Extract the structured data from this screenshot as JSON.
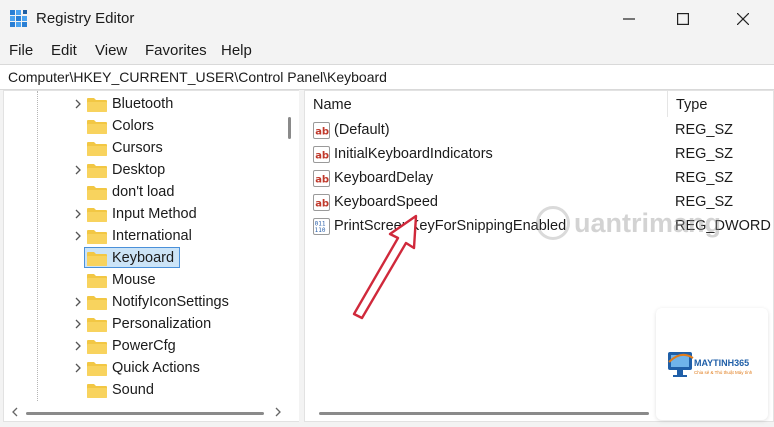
{
  "window": {
    "title": "Registry Editor",
    "icon": "registry-editor-icon",
    "controls": [
      "minimize-icon",
      "maximize-icon",
      "close-icon"
    ]
  },
  "menu": [
    "File",
    "Edit",
    "View",
    "Favorites",
    "Help"
  ],
  "address": "Computer\\HKEY_CURRENT_USER\\Control Panel\\Keyboard",
  "tree": {
    "items": [
      {
        "label": "Bluetooth",
        "expandable": true,
        "selected": false
      },
      {
        "label": "Colors",
        "expandable": false,
        "selected": false
      },
      {
        "label": "Cursors",
        "expandable": false,
        "selected": false
      },
      {
        "label": "Desktop",
        "expandable": true,
        "selected": false
      },
      {
        "label": "don't load",
        "expandable": false,
        "selected": false
      },
      {
        "label": "Input Method",
        "expandable": true,
        "selected": false
      },
      {
        "label": "International",
        "expandable": true,
        "selected": false
      },
      {
        "label": "Keyboard",
        "expandable": false,
        "selected": true
      },
      {
        "label": "Mouse",
        "expandable": false,
        "selected": false
      },
      {
        "label": "NotifyIconSettings",
        "expandable": true,
        "selected": false
      },
      {
        "label": "Personalization",
        "expandable": true,
        "selected": false
      },
      {
        "label": "PowerCfg",
        "expandable": true,
        "selected": false
      },
      {
        "label": "Quick Actions",
        "expandable": true,
        "selected": false
      },
      {
        "label": "Sound",
        "expandable": false,
        "selected": false
      }
    ]
  },
  "list": {
    "columns": {
      "name": "Name",
      "type": "Type"
    },
    "rows": [
      {
        "name": "(Default)",
        "type": "REG_SZ",
        "icon": "string-value-icon"
      },
      {
        "name": "InitialKeyboardIndicators",
        "type": "REG_SZ",
        "icon": "string-value-icon"
      },
      {
        "name": "KeyboardDelay",
        "type": "REG_SZ",
        "icon": "string-value-icon"
      },
      {
        "name": "KeyboardSpeed",
        "type": "REG_SZ",
        "icon": "string-value-icon"
      },
      {
        "name": "PrintScreenKeyForSnippingEnabled",
        "type": "REG_DWORD",
        "icon": "binary-value-icon"
      }
    ]
  },
  "watermark": {
    "text": "uantrimang"
  },
  "badge": {
    "brand": "MAYTINH365",
    "tagline": "Chia sẻ & Thủ thuật Máy tính"
  },
  "colors": {
    "selection": "#cce4f7",
    "selection_border": "#4a90d9",
    "arrow": "#d0293b",
    "folder": "#f2c744"
  }
}
